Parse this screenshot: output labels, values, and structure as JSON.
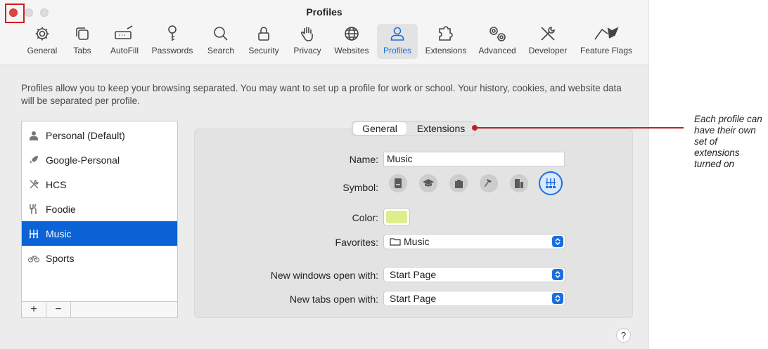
{
  "window": {
    "title": "Profiles"
  },
  "toolbar": {
    "items": [
      {
        "label": "General",
        "icon": "gear-icon"
      },
      {
        "label": "Tabs",
        "icon": "tabs-icon"
      },
      {
        "label": "AutoFill",
        "icon": "autofill-icon"
      },
      {
        "label": "Passwords",
        "icon": "key-icon"
      },
      {
        "label": "Search",
        "icon": "search-icon"
      },
      {
        "label": "Security",
        "icon": "lock-icon"
      },
      {
        "label": "Privacy",
        "icon": "hand-icon"
      },
      {
        "label": "Websites",
        "icon": "globe-icon"
      },
      {
        "label": "Profiles",
        "icon": "person-icon",
        "active": true
      },
      {
        "label": "Extensions",
        "icon": "puzzle-icon"
      },
      {
        "label": "Advanced",
        "icon": "gears-icon"
      },
      {
        "label": "Developer",
        "icon": "tools-icon"
      },
      {
        "label": "Feature Flags",
        "icon": "flags-icon"
      }
    ]
  },
  "description": "Profiles allow you to keep your browsing separated. You may want to set up a profile for work or school. Your history, cookies, and website data will be separated per profile.",
  "profiles": {
    "items": [
      {
        "label": "Personal (Default)",
        "icon": "person-icon"
      },
      {
        "label": "Google-Personal",
        "icon": "rocket-icon"
      },
      {
        "label": "HCS",
        "icon": "tools-icon"
      },
      {
        "label": "Foodie",
        "icon": "fork-knife-icon"
      },
      {
        "label": "Music",
        "icon": "music-stand-icon",
        "selected": true
      },
      {
        "label": "Sports",
        "icon": "bicycle-icon"
      }
    ],
    "add_label": "+",
    "remove_label": "−"
  },
  "tabs": {
    "general": "General",
    "extensions": "Extensions",
    "active": "general"
  },
  "form": {
    "name_label": "Name:",
    "name_value": "Music",
    "symbol_label": "Symbol:",
    "symbols": [
      "id-badge-icon",
      "graduation-cap-icon",
      "briefcase-icon",
      "hammer-icon",
      "building-icon",
      "music-stand-icon"
    ],
    "selected_symbol": "music-stand-icon",
    "color_label": "Color:",
    "color_value": "#dfee8a",
    "favorites_label": "Favorites:",
    "favorites_value": "Music",
    "new_windows_label": "New windows open with:",
    "new_windows_value": "Start Page",
    "new_tabs_label": "New tabs open with:",
    "new_tabs_value": "Start Page"
  },
  "help_label": "?",
  "annotation": {
    "text": "Each profile can have their own set of extensions turned on",
    "color": "#c01f2a"
  },
  "colors": {
    "accent": "#1a6ee0",
    "selection": "#0b63d6",
    "close": "#e0443e"
  }
}
